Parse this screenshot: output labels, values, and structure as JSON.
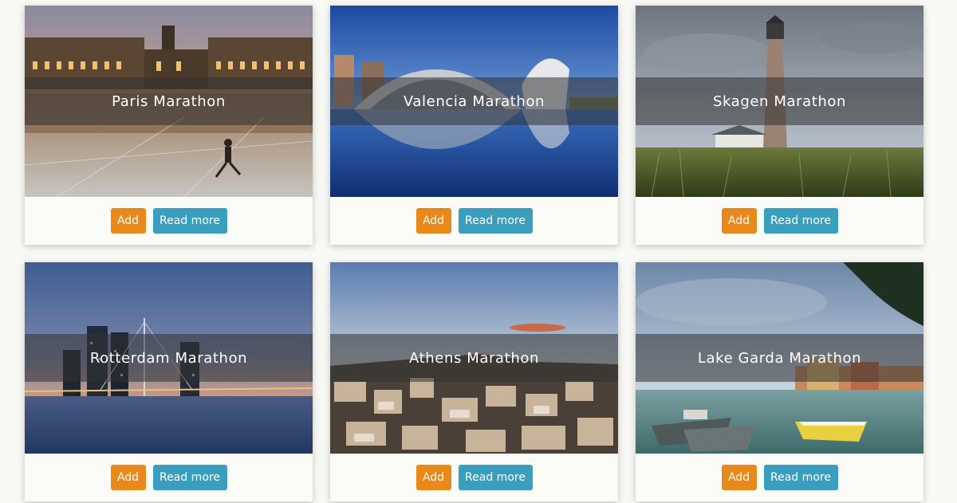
{
  "colors": {
    "page_background": "#f8f8f4",
    "add_button": "#e8891a",
    "read_more_button": "#3a9fbf",
    "title_text": "#ffffff"
  },
  "cards": [
    {
      "title": "Paris Marathon",
      "image": "city-square-reflection-at-dusk",
      "add_label": "Add",
      "more_label": "Read more"
    },
    {
      "title": "Valencia Marathon",
      "image": "futuristic-architecture-reflected-in-water",
      "add_label": "Add",
      "more_label": "Read more"
    },
    {
      "title": "Skagen Marathon",
      "image": "lighthouse-over-grass-dunes",
      "add_label": "Add",
      "more_label": "Read more"
    },
    {
      "title": "Rotterdam Marathon",
      "image": "city-skyline-with-bridge-at-night",
      "add_label": "Add",
      "more_label": "Read more"
    },
    {
      "title": "Athens Marathon",
      "image": "city-rooftops-at-sunset",
      "add_label": "Add",
      "more_label": "Read more"
    },
    {
      "title": "Lake Garda Marathon",
      "image": "lakeside-harbor-with-boats",
      "add_label": "Add",
      "more_label": "Read more"
    }
  ]
}
